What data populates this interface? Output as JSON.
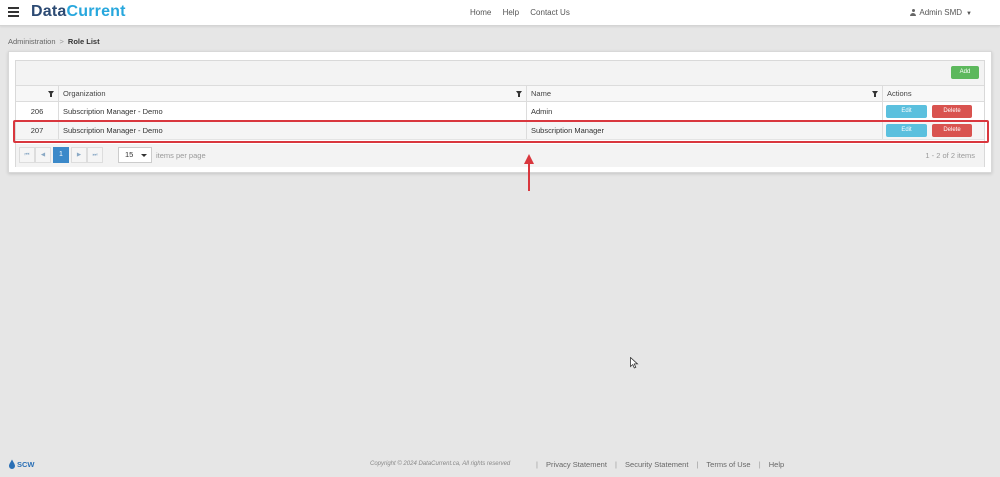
{
  "header": {
    "logo_part1": "Data",
    "logo_part2": "Current",
    "nav": [
      "Home",
      "Help",
      "Contact Us"
    ],
    "user": "Admin SMD"
  },
  "breadcrumb": {
    "root": "Administration",
    "separator": ">",
    "current": "Role List"
  },
  "grid": {
    "add_label": "Add",
    "columns": [
      "",
      "Organization",
      "Name",
      "Actions"
    ],
    "rows": [
      {
        "id": "206",
        "organization": "Subscription Manager - Demo",
        "name": "Admin",
        "edit": "Edit",
        "delete": "Delete"
      },
      {
        "id": "207",
        "organization": "Subscription Manager - Demo",
        "name": "Subscription Manager",
        "edit": "Edit",
        "delete": "Delete"
      }
    ],
    "pager": {
      "current_page": "1",
      "page_size": "15",
      "per_page_label": "items per page",
      "count_label": "1 - 2 of 2 items"
    }
  },
  "annotation": {
    "highlighted_row_id": "207",
    "color": "#d9373e"
  },
  "footer": {
    "logo_text": "SCW",
    "copyright": "Copyright © 2024 DataCurrent.ca, All rights reserved",
    "links": [
      "Privacy Statement",
      "Security Statement",
      "Terms of Use",
      "Help"
    ]
  },
  "colors": {
    "brand_dark": "#2c4a73",
    "brand_light": "#27a7dd",
    "add": "#5cb85c",
    "edit": "#5bc0de",
    "delete": "#d9534f",
    "pager_active": "#3b89c9"
  }
}
